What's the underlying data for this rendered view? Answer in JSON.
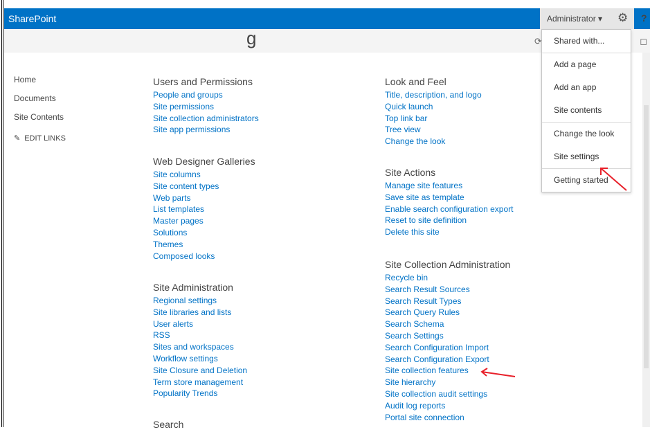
{
  "topbar": {
    "brand": "SharePoint",
    "user": "Administrator ▾",
    "help": "?"
  },
  "leftnav": {
    "items": [
      "Home",
      "Documents",
      "Site Contents"
    ],
    "edit_links": "EDIT LINKS"
  },
  "sections": {
    "users": {
      "title": "Users and Permissions",
      "links": [
        "People and groups",
        "Site permissions",
        "Site collection administrators",
        "Site app permissions"
      ]
    },
    "webdesigner": {
      "title": "Web Designer Galleries",
      "links": [
        "Site columns",
        "Site content types",
        "Web parts",
        "List templates",
        "Master pages",
        "Solutions",
        "Themes",
        "Composed looks"
      ]
    },
    "siteadmin": {
      "title": "Site Administration",
      "links": [
        "Regional settings",
        "Site libraries and lists",
        "User alerts",
        "RSS",
        "Sites and workspaces",
        "Workflow settings",
        "Site Closure and Deletion",
        "Term store management",
        "Popularity Trends"
      ]
    },
    "search": {
      "title": "Search"
    },
    "lookfeel": {
      "title": "Look and Feel",
      "links": [
        "Title, description, and logo",
        "Quick launch",
        "Top link bar",
        "Tree view",
        "Change the look"
      ]
    },
    "siteactions": {
      "title": "Site Actions",
      "links": [
        "Manage site features",
        "Save site as template",
        "Enable search configuration export",
        "Reset to site definition",
        "Delete this site"
      ]
    },
    "sitecollection": {
      "title": "Site Collection Administration",
      "links": [
        "Recycle bin",
        "Search Result Sources",
        "Search Result Types",
        "Search Query Rules",
        "Search Schema",
        "Search Settings",
        "Search Configuration Import",
        "Search Configuration Export",
        "Site collection features",
        "Site hierarchy",
        "Site collection audit settings",
        "Audit log reports",
        "Portal site connection"
      ]
    }
  },
  "menu": {
    "items": [
      "Shared with...",
      "Add a page",
      "Add an app",
      "Site contents",
      "Change the look",
      "Site settings",
      "Getting started"
    ]
  },
  "colors": {
    "brand": "#0072c6",
    "link": "#0072c6",
    "annotation": "#e8202a"
  }
}
